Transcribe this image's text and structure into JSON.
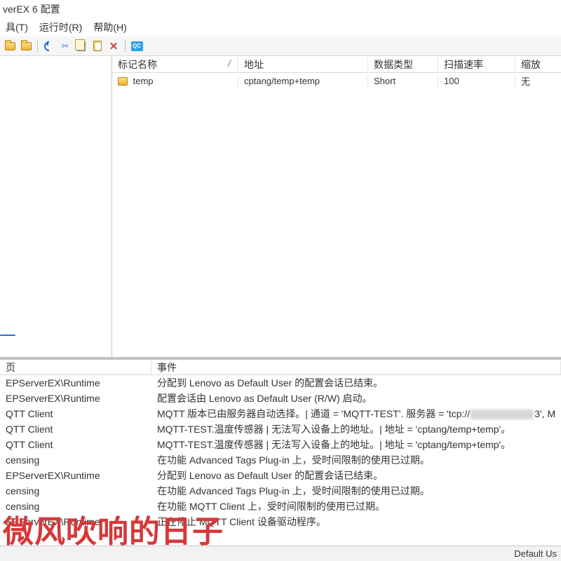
{
  "window": {
    "title": "verEX 6 配置"
  },
  "menu": {
    "tools": "具(T)",
    "runtime": "运行时(R)",
    "help": "帮助(H)"
  },
  "toolbar": {
    "qc_label": "QC"
  },
  "tag_table": {
    "columns": {
      "name": "标记名称",
      "sort": "/",
      "addr": "地址",
      "dtype": "数据类型",
      "scan": "扫描速率",
      "scale": "缩放"
    },
    "rows": [
      {
        "name": "temp",
        "addr": "cptang/temp+temp",
        "dtype": "Short",
        "scan": "100",
        "scale": "无"
      }
    ]
  },
  "log": {
    "columns": {
      "source": "页",
      "event": "事件"
    },
    "rows": [
      {
        "src": "EPServerEX\\Runtime",
        "evt": "分配到 Lenovo as Default User 的配置会话已结束。"
      },
      {
        "src": "EPServerEX\\Runtime",
        "evt": "配置会话由 Lenovo as Default User (R/W) 启动。"
      },
      {
        "src": "QTT Client",
        "evt_pre": "MQTT 版本已由服务器自动选择。| 通道 = 'MQTT-TEST'. 服务器 = 'tcp://",
        "evt_post": "3', M",
        "blurred": true
      },
      {
        "src": "QTT Client",
        "evt": "MQTT-TEST.温度传感器 | 无法写入设备上的地址。| 地址 = 'cptang/temp+temp'。"
      },
      {
        "src": "QTT Client",
        "evt": "MQTT-TEST.温度传感器 | 无法写入设备上的地址。| 地址 = 'cptang/temp+temp'。"
      },
      {
        "src": "censing",
        "evt": "在功能 Advanced Tags Plug-in 上，受时间限制的使用已过期。"
      },
      {
        "src": "EPServerEX\\Runtime",
        "evt": "分配到 Lenovo as Default User 的配置会话已结束。"
      },
      {
        "src": "censing",
        "evt": "在功能 Advanced Tags Plug-in 上，受时间限制的使用已过期。"
      },
      {
        "src": "censing",
        "evt": "在功能 MQTT Client 上，受时间限制的使用已过期。"
      },
      {
        "src": "EPServerEX\\Runtime",
        "evt": "正在停止 MQTT Client 设备驱动程序。"
      }
    ]
  },
  "status": {
    "right": "Default Us"
  },
  "watermark": "微风吹响的日子"
}
